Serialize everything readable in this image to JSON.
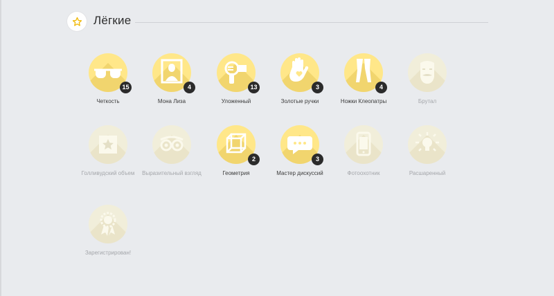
{
  "section": {
    "title": "Лёгкие",
    "icon": "star-icon"
  },
  "colors": {
    "background": "#e9ebee",
    "badge_active": "#ffe789",
    "badge_locked": "#f1eeda",
    "count_badge": "#2b2b2b"
  },
  "badges": [
    {
      "label": "Четкость",
      "count": "15",
      "icon": "glasses-icon",
      "unlocked": true
    },
    {
      "label": "Мона Лиза",
      "count": "4",
      "icon": "mona-lisa-icon",
      "unlocked": true
    },
    {
      "label": "Уложенный",
      "count": "13",
      "icon": "hairdryer-icon",
      "unlocked": true
    },
    {
      "label": "Золотые ручки",
      "count": "3",
      "icon": "hand-heart-icon",
      "unlocked": true
    },
    {
      "label": "Ножки Клеопатры",
      "count": "4",
      "icon": "legs-icon",
      "unlocked": true
    },
    {
      "label": "Брутал",
      "count": "",
      "icon": "mustache-face-icon",
      "unlocked": false
    },
    {
      "label": "Голливудский объем",
      "count": "",
      "icon": "hollywood-star-icon",
      "unlocked": false
    },
    {
      "label": "Выразительный взгляд",
      "count": "",
      "icon": "eyes-icon",
      "unlocked": false
    },
    {
      "label": "Геометрия",
      "count": "2",
      "icon": "cube-icon",
      "unlocked": true
    },
    {
      "label": "Мастер дискуссий",
      "count": "3",
      "icon": "chat-bubble-icon",
      "unlocked": true
    },
    {
      "label": "Фотоохотник",
      "count": "",
      "icon": "phone-photo-icon",
      "unlocked": false
    },
    {
      "label": "Расшаренный",
      "count": "",
      "icon": "light-bulb-icon",
      "unlocked": false
    },
    {
      "label": "Зарегистрирован!",
      "count": "",
      "icon": "rosette-icon",
      "unlocked": false
    }
  ]
}
